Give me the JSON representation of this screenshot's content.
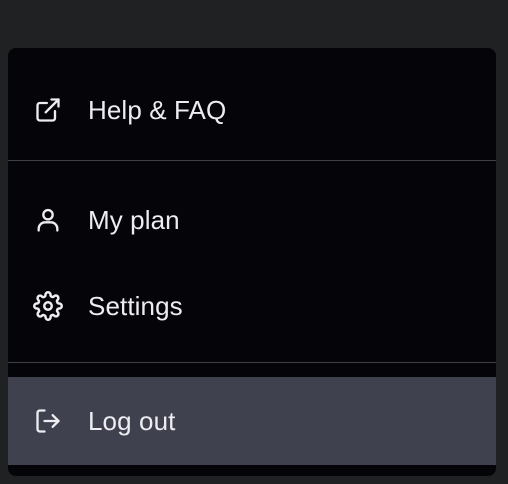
{
  "menu": {
    "items": [
      {
        "label": "Help & FAQ",
        "icon": "external-link-icon"
      },
      {
        "label": "My plan",
        "icon": "user-icon"
      },
      {
        "label": "Settings",
        "icon": "gear-icon"
      },
      {
        "label": "Log out",
        "icon": "logout-icon"
      }
    ]
  },
  "colors": {
    "background": "#202123",
    "menu_bg": "#050509",
    "hover_bg": "#40414f",
    "divider": "#3f4046",
    "text": "#ececf1"
  }
}
